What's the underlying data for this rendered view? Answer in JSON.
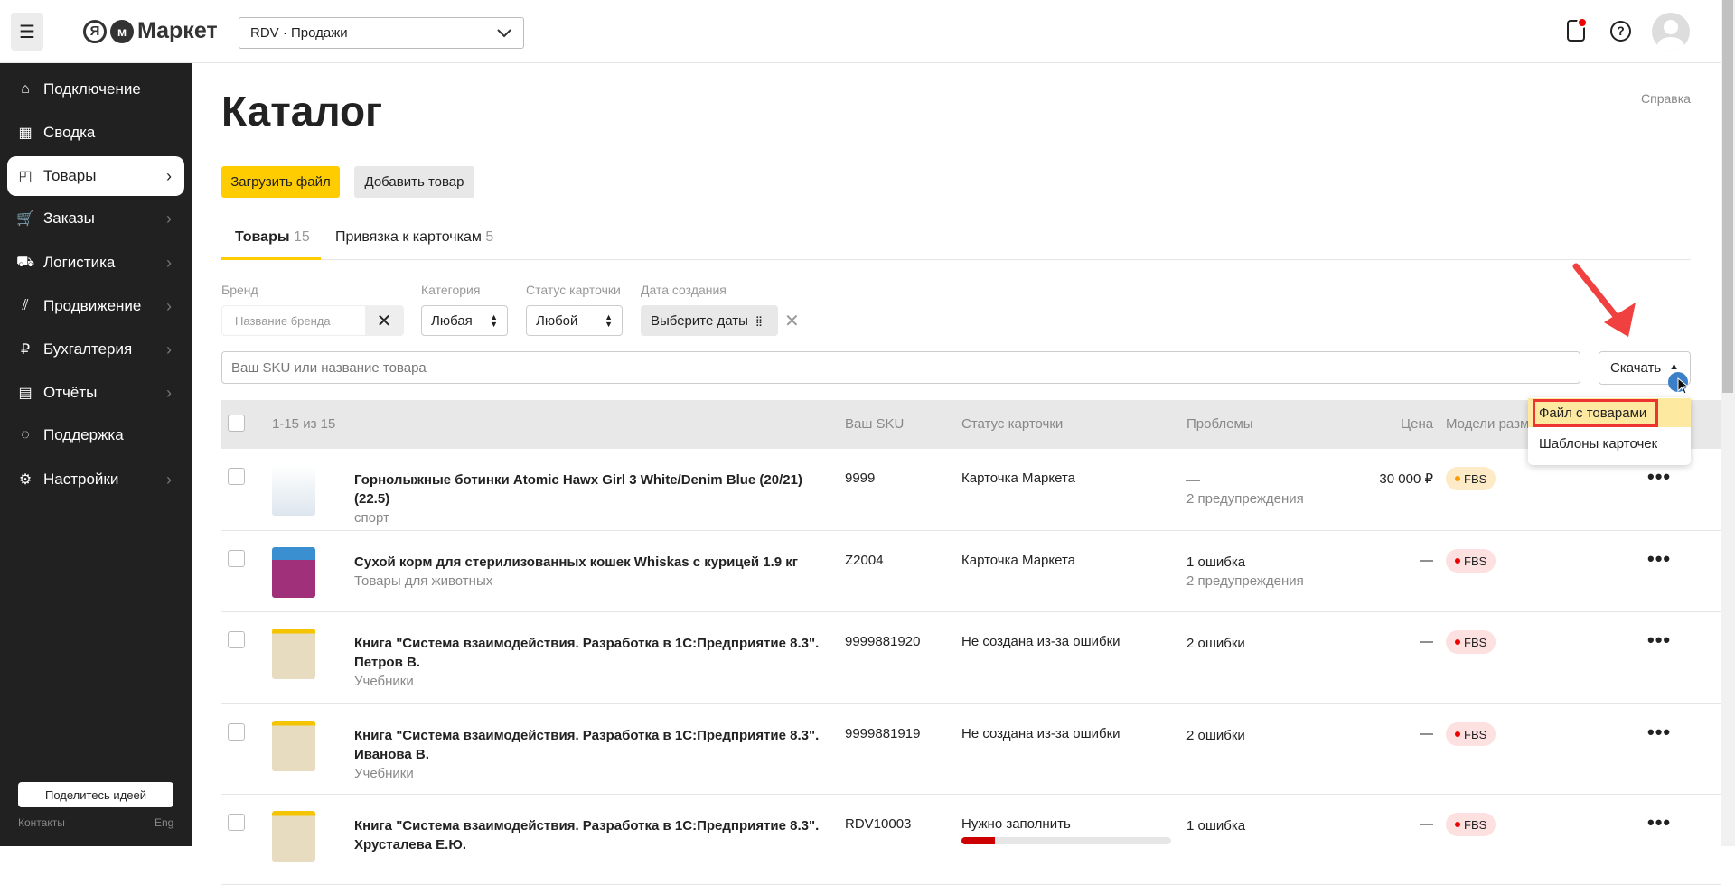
{
  "header": {
    "campaign": "RDV · Продажи",
    "logo": "Я Маркет"
  },
  "sidebar": {
    "items": [
      {
        "label": "Подключение",
        "icon": "store-icon",
        "glyph": "⌂",
        "chev": false
      },
      {
        "label": "Сводка",
        "icon": "dashboard-icon",
        "glyph": "▦",
        "chev": false
      },
      {
        "label": "Товары",
        "icon": "box-icon",
        "glyph": "◰",
        "chev": true,
        "active": true
      },
      {
        "label": "Заказы",
        "icon": "cart-icon",
        "glyph": "🛒",
        "chev": true
      },
      {
        "label": "Логистика",
        "icon": "truck-icon",
        "glyph": "⛟",
        "chev": true
      },
      {
        "label": "Продвижение",
        "icon": "chart-icon",
        "glyph": "⫽",
        "chev": true
      },
      {
        "label": "Бухгалтерия",
        "icon": "ruble-icon",
        "glyph": "₽",
        "chev": true
      },
      {
        "label": "Отчёты",
        "icon": "report-icon",
        "glyph": "▤",
        "chev": true
      },
      {
        "label": "Поддержка",
        "icon": "chat-icon",
        "glyph": "◌",
        "chev": false
      },
      {
        "label": "Настройки",
        "icon": "gear-icon",
        "glyph": "⚙",
        "chev": true
      }
    ],
    "share": "Поделитесь идеей",
    "contacts": "Контакты",
    "lang": "Eng"
  },
  "page": {
    "title": "Каталог",
    "help": "Справка",
    "upload": "Загрузить файл",
    "add": "Добавить товар",
    "tabs": [
      {
        "label": "Товары",
        "count": "15"
      },
      {
        "label": "Привязка к карточкам",
        "count": "5"
      }
    ]
  },
  "filters": {
    "brand_label": "Бренд",
    "brand_placeholder": "Название бренда",
    "category_label": "Категория",
    "category_value": "Любая",
    "status_label": "Статус карточки",
    "status_value": "Любой",
    "date_label": "Дата создания",
    "date_value": "Выберите даты",
    "search_placeholder": "Ваш SKU или название товара",
    "download": "Скачать"
  },
  "download_menu": [
    "Файл с товарами",
    "Шаблоны карточек"
  ],
  "table": {
    "count": "1-15 из 15",
    "columns": {
      "sku": "Ваш SKU",
      "status": "Статус карточки",
      "problems": "Проблемы",
      "price": "Цена",
      "models": "Модели разм"
    },
    "rows": [
      {
        "name": "Горнолыжные ботинки Atomic Hawx Girl 3 White/Denim Blue (20/21) (22.5)",
        "category": "спорт",
        "sku": "9999",
        "status": "Карточка Маркета",
        "problem1": "—",
        "problem2": "2 предупреждения",
        "price": "30 000 ₽",
        "model": "FBS",
        "model_color": "#ff9900",
        "model_bg": "#fdebc8"
      },
      {
        "name": "Сухой корм для стерилизованных кошек Whiskas с курицей 1.9 кг",
        "category": "Товары для животных",
        "sku": "Z2004",
        "status": "Карточка Маркета",
        "problem1": "1 ошибка",
        "problem2": "2 предупреждения",
        "price": "—",
        "model": "FBS",
        "model_color": "#e00",
        "model_bg": "#fde0e0"
      },
      {
        "name": "Книга \"Система взаимодействия. Разработка в 1С:Предприятие 8.3\". Петров В.",
        "category": "Учебники",
        "sku": "9999881920",
        "status": "Не создана из-за ошибки",
        "problem1": "2 ошибки",
        "problem2": "",
        "price": "—",
        "model": "FBS",
        "model_color": "#e00",
        "model_bg": "#fde0e0"
      },
      {
        "name": "Книга \"Система взаимодействия. Разработка в 1С:Предприятие 8.3\". Иванова В.",
        "category": "Учебники",
        "sku": "9999881919",
        "status": "Не создана из-за ошибки",
        "problem1": "2 ошибки",
        "problem2": "",
        "price": "—",
        "model": "FBS",
        "model_color": "#e00",
        "model_bg": "#fde0e0"
      },
      {
        "name": "Книга \"Система взаимодействия. Разработка в 1С:Предприятие 8.3\". Хрусталева Е.Ю.",
        "category": "",
        "sku": "RDV10003",
        "status": "Нужно заполнить",
        "problem1": "1 ошибка",
        "problem2": "",
        "price": "—",
        "model": "FBS",
        "model_color": "#e00",
        "model_bg": "#fde0e0",
        "fill_progress": 0.16
      }
    ]
  }
}
